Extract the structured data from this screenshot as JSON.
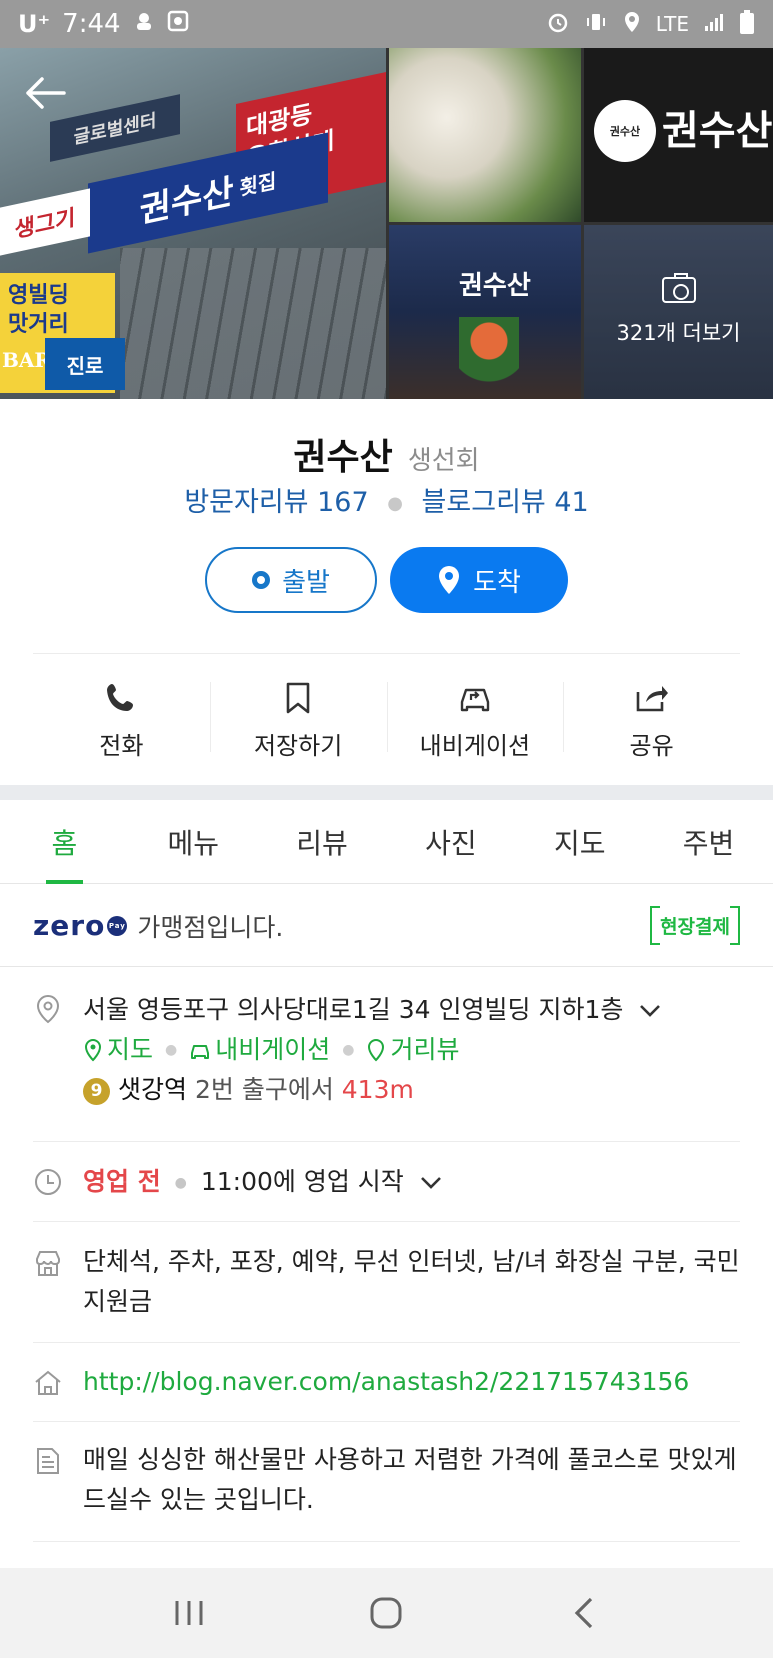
{
  "status_bar": {
    "carrier": "U⁺",
    "time": "7:44",
    "network": "LTE"
  },
  "photos": {
    "more_label": "321개 더보기",
    "sign_main": "권수산",
    "sign_main_suffix": "횟집",
    "sign_red": "대광등\n유황삼계",
    "sign_white": "생그기",
    "sign_yellow": "영빌딩\n맛거리",
    "sign_bar": "BAR",
    "sign_blue": "진로",
    "p2_logo": "권수산",
    "p2_text": "권수산",
    "p3_text": "권수산"
  },
  "place": {
    "name": "권수산",
    "category": "생선회",
    "visitor_reviews": "방문자리뷰 167",
    "blog_reviews": "블로그리뷰 41"
  },
  "route": {
    "start_label": "출발",
    "end_label": "도착"
  },
  "actions": [
    {
      "label": "전화",
      "icon": "phone-icon"
    },
    {
      "label": "저장하기",
      "icon": "bookmark-icon"
    },
    {
      "label": "내비게이션",
      "icon": "car-navigation-icon"
    },
    {
      "label": "공유",
      "icon": "share-icon"
    }
  ],
  "tabs": [
    "홈",
    "메뉴",
    "리뷰",
    "사진",
    "지도",
    "주변"
  ],
  "active_tab": "홈",
  "zero_pay": {
    "logo": "zero",
    "logo_badge": "Pay",
    "text": "가맹점입니다.",
    "onsite_label": "현장결제"
  },
  "address": {
    "text": "서울 영등포구 의사당대로1길 34 인영빌딩 지하1층",
    "map_link": "지도",
    "navi_link": "내비게이션",
    "street_link": "거리뷰",
    "station_line": "9",
    "station_name": "샛강역",
    "exit_text": "2번 출구에서",
    "distance": "413m"
  },
  "hours": {
    "status": "영업 전",
    "text": "11:00에 영업 시작"
  },
  "facilities": {
    "text": "단체석, 주차, 포장, 예약, 무선 인터넷, 남/녀 화장실 구분, 국민지원금"
  },
  "website": {
    "url": "http://blog.naver.com/anastash2/221715743156"
  },
  "description": {
    "text": "매일 싱싱한 해산물만 사용하고 저렴한 가격에 풀코스로 맛있게 드실수 있는 곳입니다."
  },
  "colors": {
    "accent_green": "#1faa3f",
    "accent_blue": "#0a7af0",
    "review_blue": "#1e5fa8",
    "alert_red": "#e4474a"
  }
}
